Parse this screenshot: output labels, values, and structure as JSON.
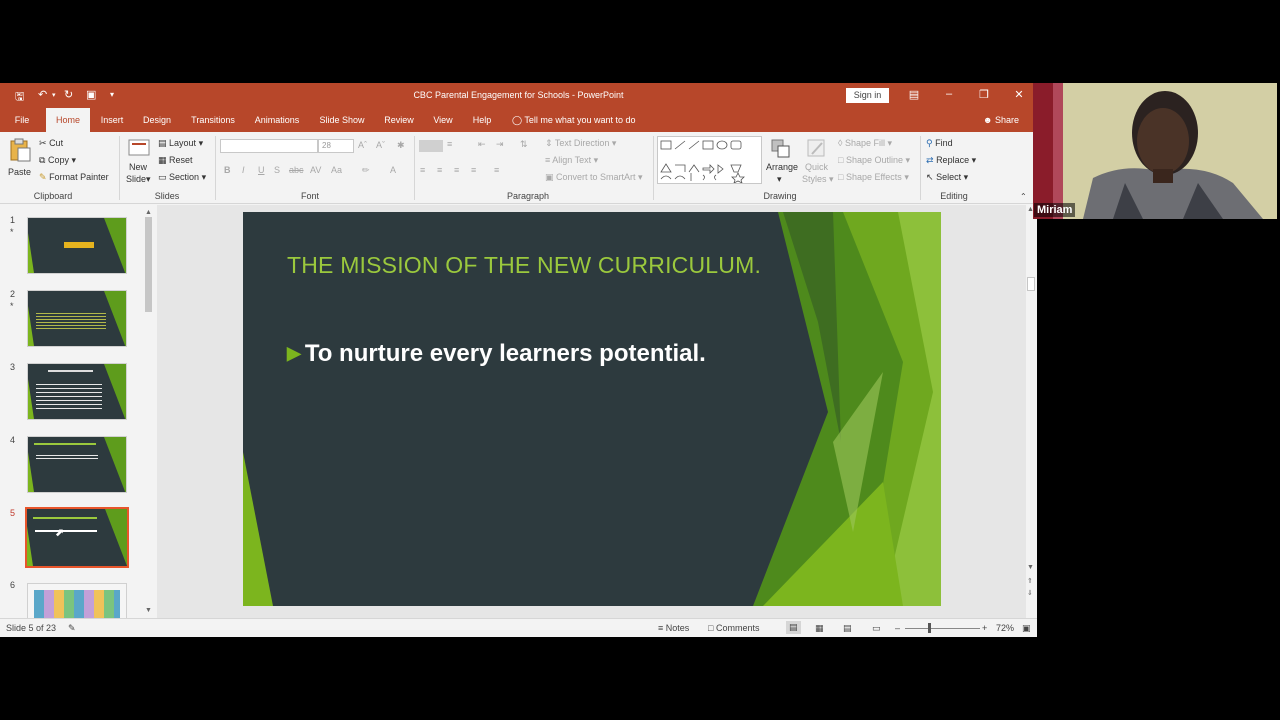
{
  "window": {
    "title": "CBC Parental Engagement for Schools  -  PowerPoint",
    "sign_in": "Sign in"
  },
  "tabs": [
    "File",
    "Home",
    "Insert",
    "Design",
    "Transitions",
    "Animations",
    "Slide Show",
    "Review",
    "View",
    "Help"
  ],
  "active_tab": "Home",
  "tell_me": "Tell me what you want to do",
  "share": "Share",
  "ribbon": {
    "clipboard": {
      "label": "Clipboard",
      "paste": "Paste",
      "cut": "Cut",
      "copy": "Copy",
      "format_painter": "Format Painter"
    },
    "slides": {
      "label": "Slides",
      "new_slide_1": "New",
      "new_slide_2": "Slide",
      "layout": "Layout",
      "reset": "Reset",
      "section": "Section"
    },
    "font": {
      "label": "Font",
      "size": "28"
    },
    "paragraph": {
      "label": "Paragraph",
      "text_direction": "Text Direction",
      "align_text": "Align Text",
      "convert_smartart": "Convert to SmartArt"
    },
    "drawing": {
      "label": "Drawing",
      "arrange": "Arrange",
      "quick_styles_1": "Quick",
      "quick_styles_2": "Styles",
      "shape_fill": "Shape Fill",
      "shape_outline": "Shape Outline",
      "shape_effects": "Shape Effects"
    },
    "editing": {
      "label": "Editing",
      "find": "Find",
      "replace": "Replace",
      "select": "Select"
    }
  },
  "thumbnails": [
    {
      "num": "1",
      "star": "*"
    },
    {
      "num": "2",
      "star": "*"
    },
    {
      "num": "3",
      "star": ""
    },
    {
      "num": "4",
      "star": ""
    },
    {
      "num": "5",
      "star": ""
    },
    {
      "num": "6",
      "star": ""
    }
  ],
  "slide": {
    "title": "THE MISSION OF THE NEW CURRICULUM.",
    "bullet": "To nurture every learners potential."
  },
  "status": {
    "slide_count": "Slide 5 of 23",
    "notes": "Notes",
    "comments": "Comments",
    "zoom": "72%"
  },
  "webcam": {
    "name": "Miriam"
  },
  "colors": {
    "accent": "#b7472a",
    "slide_bg": "#2d3a3e",
    "slide_title": "#9bc93d",
    "slide_green": "#7cb51e"
  }
}
